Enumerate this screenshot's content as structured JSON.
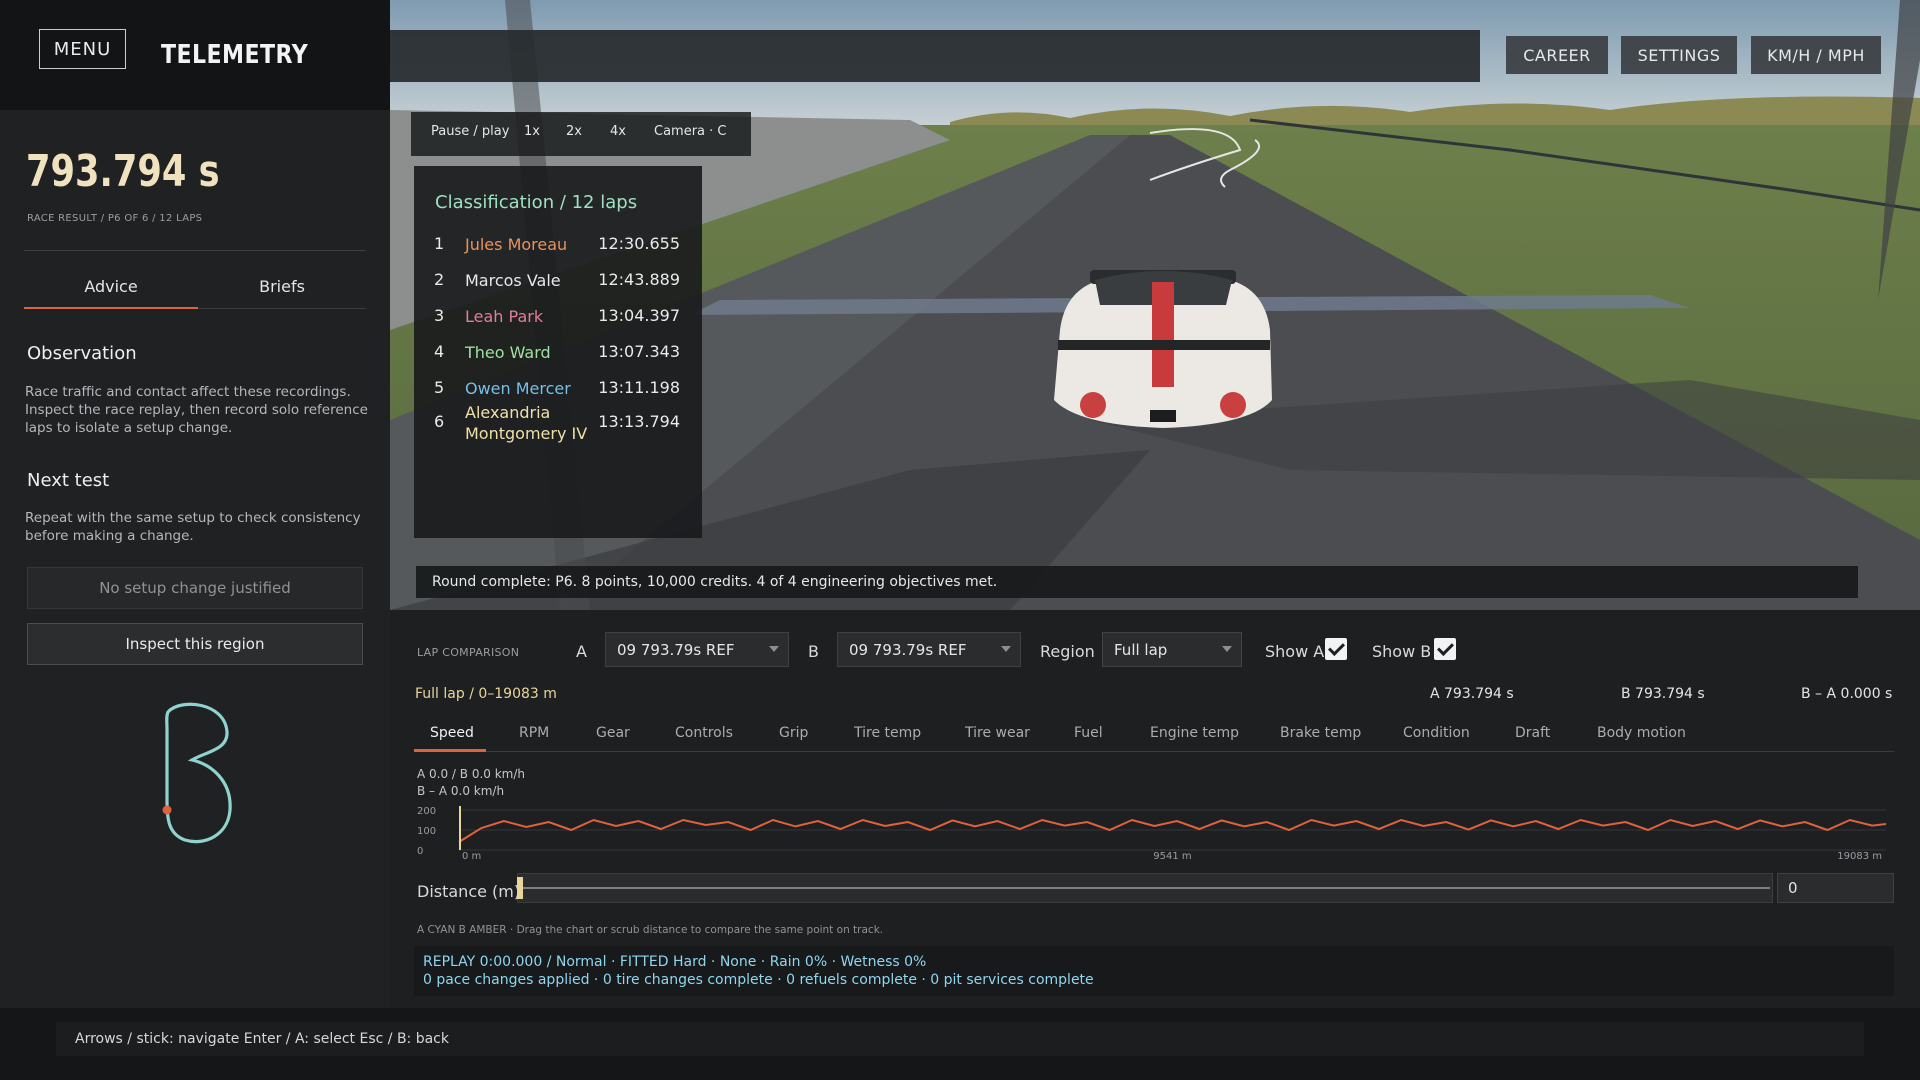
{
  "header": {
    "menu_label": "MENU",
    "title": "TELEMETRY",
    "buttons": {
      "career": "CAREER",
      "settings": "SETTINGS",
      "units": "KM/H / MPH"
    }
  },
  "sidebar": {
    "race_time": "793.794 s",
    "race_subtitle": "RACE RESULT / P6 OF 6 / 12 LAPS",
    "tabs": {
      "advice": "Advice",
      "briefs": "Briefs",
      "active": "advice"
    },
    "observation_heading": "Observation",
    "observation_text": "Race traffic and contact affect these recordings. Inspect the race replay, then record solo reference laps to isolate a setup change.",
    "next_test_heading": "Next test",
    "next_test_text": "Repeat with the same setup to check consistency before making a change.",
    "no_change_label": "No setup change justified",
    "inspect_label": "Inspect this region"
  },
  "playback": {
    "pause_play": "Pause / play",
    "speed_1x": "1x",
    "speed_2x": "2x",
    "speed_4x": "4x",
    "camera": "Camera · C"
  },
  "classification": {
    "title": "Classification / 12 laps",
    "rows": [
      {
        "pos": "1",
        "name": "Jules Moreau",
        "time": "12:30.655",
        "color": "#e8935a"
      },
      {
        "pos": "2",
        "name": "Marcos Vale",
        "time": "12:43.889",
        "color": "#e6e8ea"
      },
      {
        "pos": "3",
        "name": "Leah Park",
        "time": "13:04.397",
        "color": "#e27d9b"
      },
      {
        "pos": "4",
        "name": "Theo Ward",
        "time": "13:07.343",
        "color": "#9ee0a0"
      },
      {
        "pos": "5",
        "name": "Owen Mercer",
        "time": "13:11.198",
        "color": "#78bfe6"
      },
      {
        "pos": "6",
        "name": "Alexandria Montgomery IV",
        "time": "13:13.794",
        "color": "#efe0a8"
      }
    ]
  },
  "round_message": "Round complete: P6. 8 points, 10,000 credits. 4 of 4 engineering objectives met.",
  "telemetry": {
    "lap_comparison_label": "LAP COMPARISON",
    "a_label": "A",
    "a_value": "09 793.79s REF",
    "b_label": "B",
    "b_value": "09 793.79s REF",
    "region_label": "Region",
    "region_value": "Full lap",
    "show_a_label": "Show A",
    "show_a_checked": true,
    "show_b_label": "Show B",
    "show_b_checked": true,
    "range_line": "Full lap / 0–19083 m",
    "stat_a": "A 793.794 s",
    "stat_b": "B 793.794 s",
    "stat_diff": "B – A 0.000 s",
    "tabs": [
      "Speed",
      "RPM",
      "Gear",
      "Controls",
      "Grip",
      "Tire temp",
      "Tire wear",
      "Fuel",
      "Engine temp",
      "Brake temp",
      "Condition",
      "Draft",
      "Body motion"
    ],
    "active_tab": "Speed",
    "distance_label": "Distance (m)",
    "distance_value": "0",
    "distance_fraction": 0,
    "legend_hint": "A CYAN B AMBER · Drag the chart or scrub distance to compare the same point on track.",
    "replay_line1": "REPLAY 0:00.000 / Normal · FITTED Hard · None · Rain 0% · Wetness 0%",
    "replay_line2": "0 pace changes applied · 0 tire changes complete · 0 refuels complete · 0 pit services complete"
  },
  "chart_data": {
    "type": "line",
    "readout_1": "A 0.0 / B 0.0 km/h",
    "readout_2": "B – A 0.0 km/h",
    "y_ticks": [
      "200",
      "100",
      "0"
    ],
    "ylim": [
      0,
      200
    ],
    "x_ticks": [
      "0 m",
      "9541 m",
      "19083 m"
    ],
    "xlim": [
      0,
      19083
    ],
    "series_color": "#e0623d",
    "x": [
      0,
      300,
      600,
      900,
      1200,
      1500,
      1800,
      2100,
      2400,
      2700,
      3000,
      3300,
      3600,
      3900,
      4200,
      4500,
      4800,
      5100,
      5400,
      5700,
      6000,
      6300,
      6600,
      6900,
      7200,
      7500,
      7800,
      8100,
      8400,
      8700,
      9000,
      9300,
      9600,
      9900,
      10200,
      10500,
      10800,
      11100,
      11400,
      11700,
      12000,
      12300,
      12600,
      12900,
      13200,
      13500,
      13800,
      14100,
      14400,
      14700,
      15000,
      15300,
      15600,
      15900,
      16200,
      16500,
      16800,
      17100,
      17400,
      17700,
      18000,
      18300,
      18600,
      18900,
      19083
    ],
    "series": [
      {
        "values": [
          40,
          110,
          145,
          115,
          140,
          100,
          150,
          120,
          145,
          105,
          150,
          125,
          140,
          100,
          150,
          118,
          145,
          105,
          150,
          120,
          140,
          100,
          148,
          118,
          145,
          105,
          150,
          122,
          140,
          100,
          150,
          120,
          145,
          105,
          148,
          118,
          140,
          100,
          150,
          122,
          145,
          105,
          150,
          120,
          140,
          102,
          148,
          118,
          145,
          105,
          150,
          122,
          140,
          100,
          150,
          120,
          145,
          105,
          148,
          118,
          140,
          100,
          150,
          122,
          130
        ]
      }
    ]
  }
}
